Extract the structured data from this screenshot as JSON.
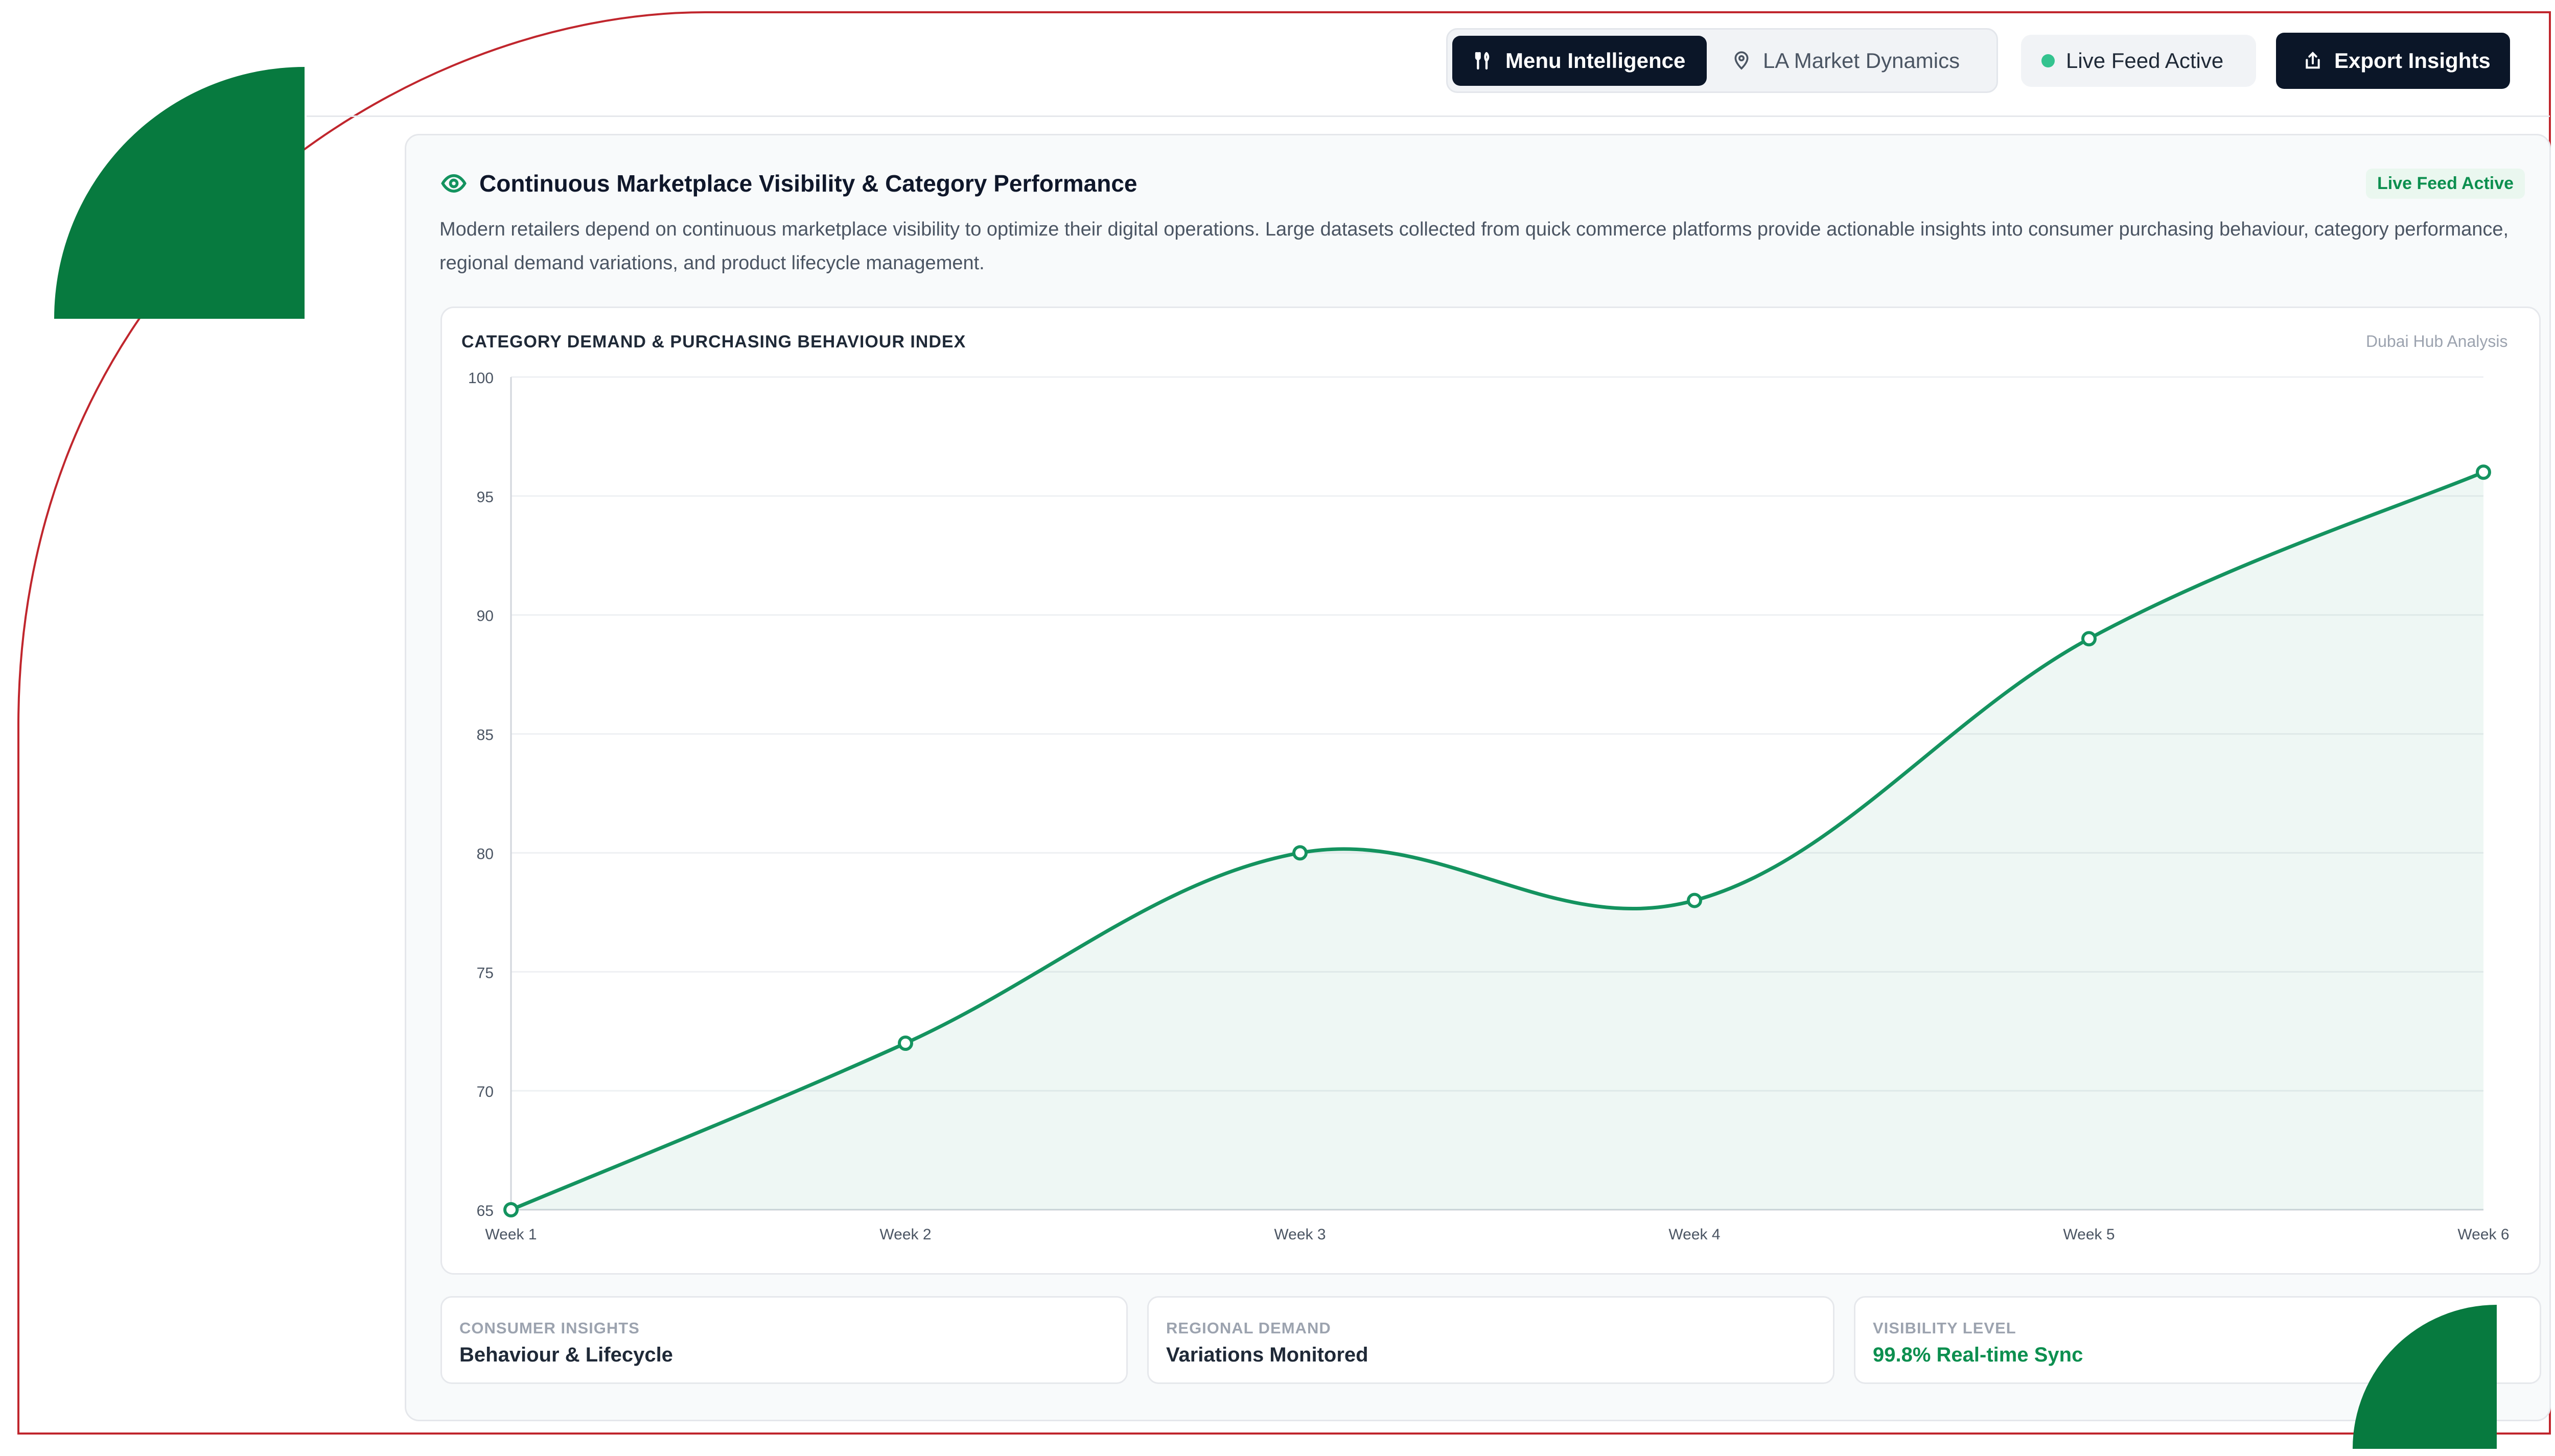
{
  "header": {
    "tabs": [
      {
        "label": "Menu Intelligence",
        "icon": "fork-knife-icon",
        "active": true
      },
      {
        "label": "LA Market Dynamics",
        "icon": "map-pin-icon",
        "active": false
      }
    ],
    "status_label": "Live Feed Active",
    "export_label": "Export Insights"
  },
  "card": {
    "title": "Continuous Marketplace Visibility & Category Performance",
    "badge": "Live Feed Active",
    "description": "Modern retailers depend on continuous marketplace visibility to optimize their digital operations. Large datasets collected from quick commerce platforms provide actionable insights into consumer purchasing behaviour, category performance, regional demand variations, and product lifecycle management."
  },
  "chart_data": {
    "type": "area",
    "title": "CATEGORY DEMAND & PURCHASING BEHAVIOUR INDEX",
    "subtitle": "Dubai Hub Analysis",
    "categories": [
      "Week 1",
      "Week 2",
      "Week 3",
      "Week 4",
      "Week 5",
      "Week 6"
    ],
    "series": [
      {
        "values": [
          65,
          72,
          80,
          78,
          89,
          96
        ]
      }
    ],
    "ylim": [
      65,
      100
    ],
    "yticks": [
      100,
      95,
      90,
      85,
      80,
      75,
      70,
      65
    ],
    "grid": true,
    "color": "#14935f"
  },
  "stats": [
    {
      "label": "CONSUMER INSIGHTS",
      "value": "Behaviour & Lifecycle"
    },
    {
      "label": "REGIONAL DEMAND",
      "value": "Variations Monitored"
    },
    {
      "label": "VISIBILITY LEVEL",
      "value": "99.8% Real-time Sync"
    }
  ],
  "colors": {
    "brand": "#077a3f",
    "accent": "#14935f",
    "dark": "#0b1628",
    "frame": "#c0262d"
  }
}
